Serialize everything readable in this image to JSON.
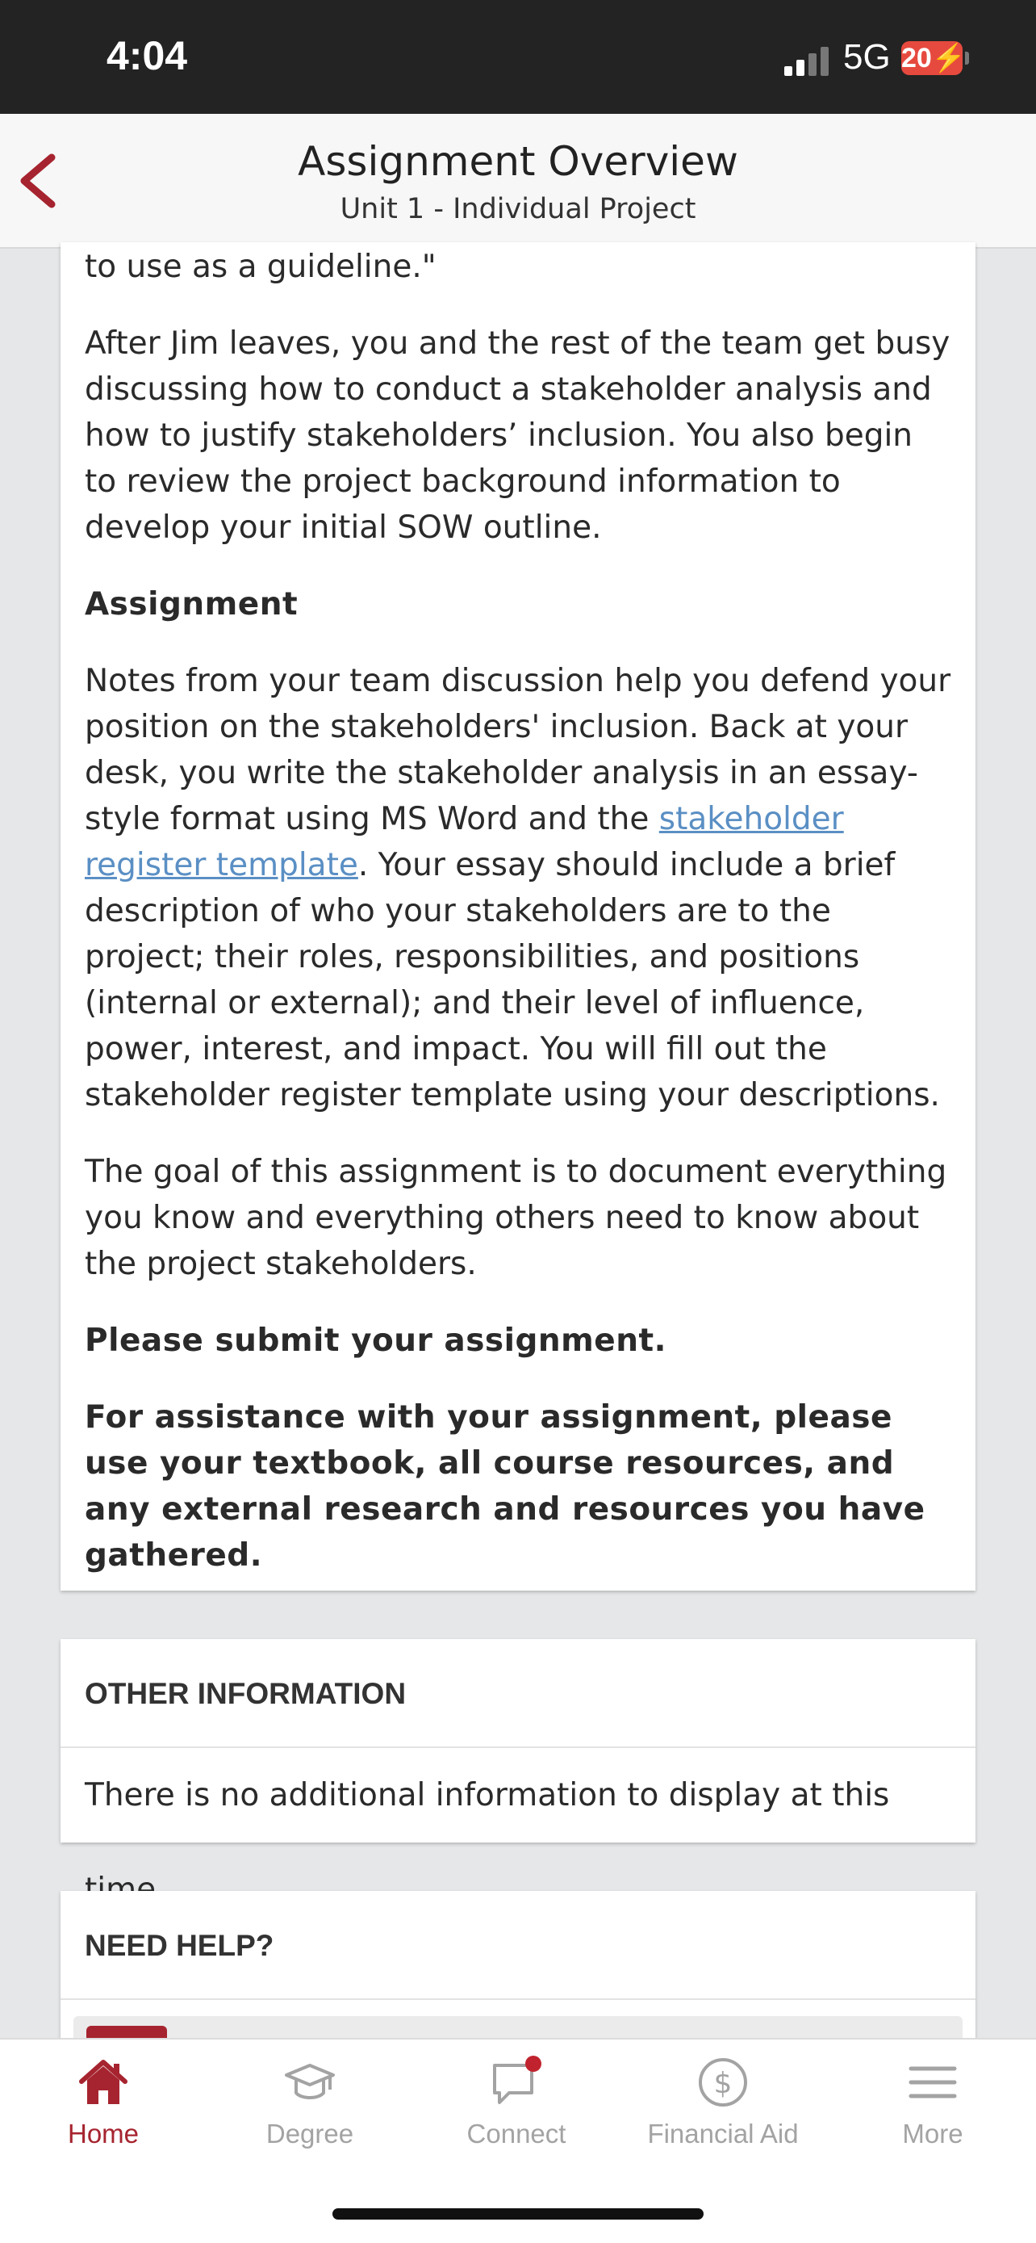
{
  "status": {
    "time": "4:04",
    "network": "5G",
    "battery": "20"
  },
  "nav": {
    "title": "Assignment Overview",
    "subtitle": "Unit 1 - Individual Project"
  },
  "content": {
    "p0": "to use as a guideline.\"",
    "p1": "After Jim leaves, you and the rest of the team get busy discussing how to conduct a stakeholder analysis and how to justify stakeholders’ inclusion. You also begin to review the project background information to develop your initial SOW outline.",
    "heading": "Assignment",
    "p2_before": "Notes from your team discussion help you defend your position on the stakeholders' inclusion. Back at your desk, you write the stakeholder analysis in an essay-style format using MS Word and the ",
    "p2_link": "stakeholder register template",
    "p2_after": ". Your essay should include a brief description of who your stakeholders are to the project; their roles, responsibilities, and positions (internal or external); and their level of influence, power, interest, and impact. You will fill out the stakeholder register template using your descriptions.",
    "p3": "The goal of this assignment is to document everything you know and everything others need to know about the project stakeholders.",
    "p4": "Please submit your assignment.",
    "p5": "For assistance with your assignment, please use your textbook, all course resources, and any external research and resources you have gathered."
  },
  "other_info": {
    "header": "OTHER INFORMATION",
    "text": "There is no additional information to display at this time."
  },
  "need_help": {
    "header": "NEED HELP?"
  },
  "tabs": [
    {
      "label": "Home",
      "icon": "home-icon",
      "active": true
    },
    {
      "label": "Degree",
      "icon": "graduation-cap-icon",
      "active": false
    },
    {
      "label": "Connect",
      "icon": "chat-icon",
      "active": false
    },
    {
      "label": "Financial Aid",
      "icon": "dollar-icon",
      "active": false
    },
    {
      "label": "More",
      "icon": "menu-icon",
      "active": false
    }
  ],
  "colors": {
    "brand": "#a6242f",
    "link": "#5a8fc4",
    "inactive": "#a3a3a3",
    "badge": "#c0232e"
  }
}
